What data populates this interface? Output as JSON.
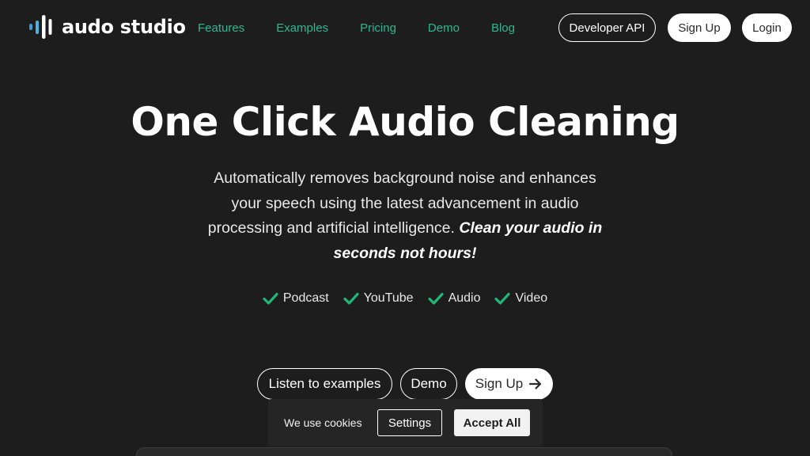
{
  "brand": {
    "name": "audo studio",
    "icon": "audio-bars-logo-icon"
  },
  "nav": {
    "items": [
      {
        "label": "Features"
      },
      {
        "label": "Examples"
      },
      {
        "label": "Pricing"
      },
      {
        "label": "Demo"
      },
      {
        "label": "Blog"
      }
    ],
    "developer_api": "Developer API",
    "sign_up": "Sign Up",
    "login": "Login"
  },
  "hero": {
    "title": "One Click Audio Cleaning",
    "description": "Automatically removes background noise and enhances your speech using the latest advancement in audio processing and artificial intelligence.",
    "emphasis": "Clean your audio in seconds not hours!",
    "tags": [
      {
        "label": "Podcast",
        "icon": "check-icon"
      },
      {
        "label": "YouTube",
        "icon": "check-icon"
      },
      {
        "label": "Audio",
        "icon": "check-icon"
      },
      {
        "label": "Video",
        "icon": "check-icon"
      }
    ]
  },
  "cta": {
    "examples": "Listen to examples",
    "demo": "Demo",
    "sign_up": "Sign Up",
    "sign_up_icon": "arrow-right-icon"
  },
  "cookie": {
    "message": "We use cookies",
    "settings": "Settings",
    "accept": "Accept All"
  },
  "colors": {
    "background": "#1d1d1d",
    "accent_green": "#2fb88c",
    "check_green": "#1fb877",
    "logo_blue": "#3a9bd9"
  }
}
